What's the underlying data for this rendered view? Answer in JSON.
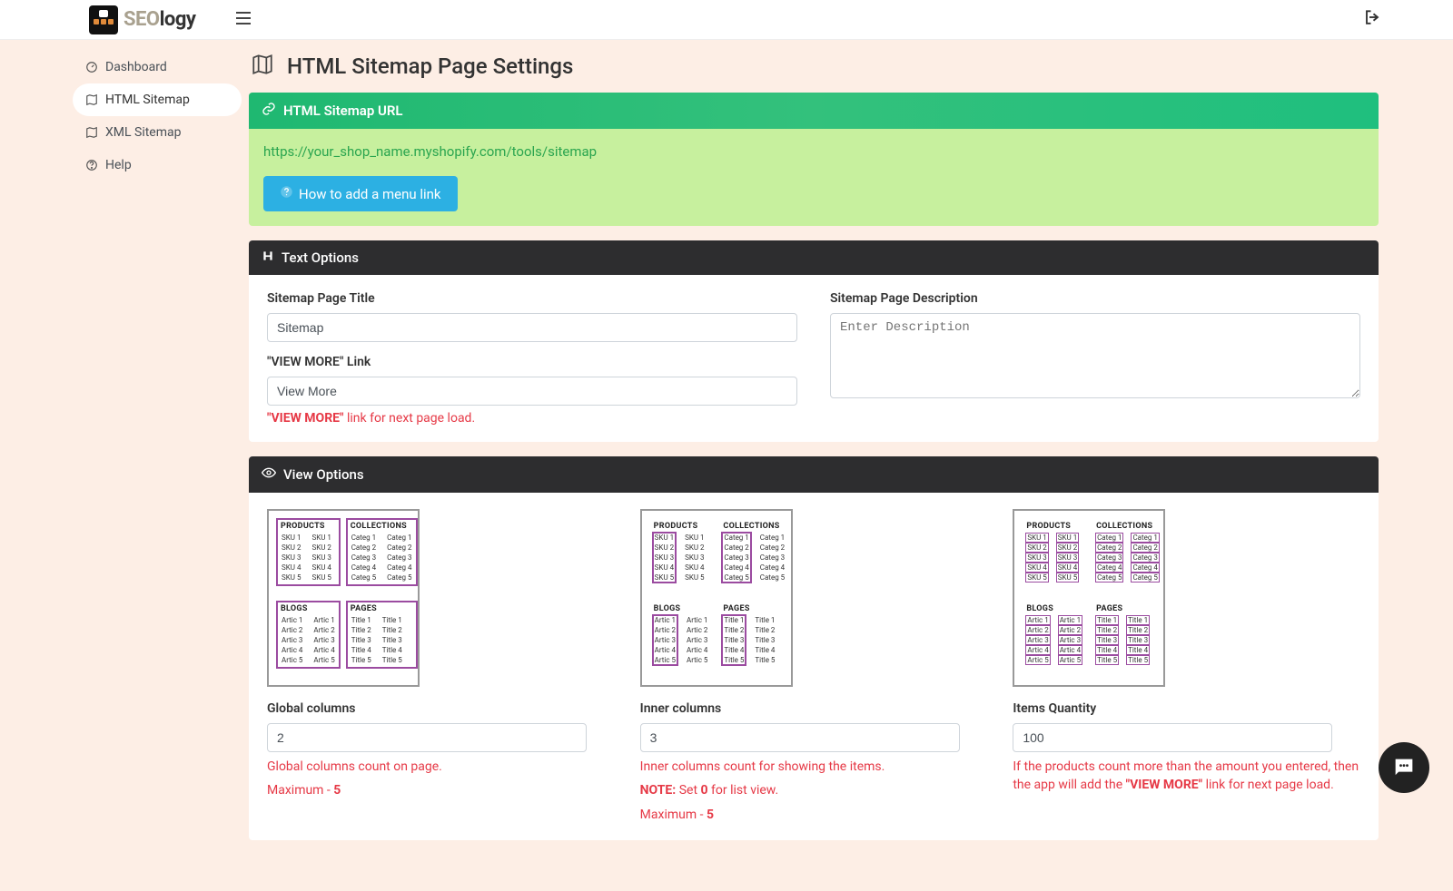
{
  "brand": {
    "seo": "SEO",
    "logy": "logy"
  },
  "sidebar": {
    "items": [
      {
        "label": "Dashboard",
        "icon": "dashboard-icon"
      },
      {
        "label": "HTML Sitemap",
        "icon": "map-icon",
        "active": true
      },
      {
        "label": "XML Sitemap",
        "icon": "map-icon"
      },
      {
        "label": "Help",
        "icon": "help-icon"
      }
    ]
  },
  "page": {
    "title": "HTML Sitemap Page Settings"
  },
  "urlPanel": {
    "heading": "HTML Sitemap URL",
    "url": "https://your_shop_name.myshopify.com/tools/sitemap",
    "howto": "How to add a menu link"
  },
  "textOptions": {
    "heading": "Text Options",
    "titleLabel": "Sitemap Page Title",
    "titleValue": "Sitemap",
    "descLabel": "Sitemap Page Description",
    "descPlaceholder": "Enter Description",
    "viewMoreLabel": "\"VIEW MORE\" Link",
    "viewMoreValue": "View More",
    "viewMoreHelpStrong": "\"VIEW MORE\"",
    "viewMoreHelpRest": " link for next page load."
  },
  "viewOptions": {
    "heading": "View Options",
    "preview": {
      "sections": [
        "PRODUCTS",
        "COLLECTIONS",
        "BLOGS",
        "PAGES"
      ],
      "sku": [
        "SKU 1",
        "SKU 2",
        "SKU 3",
        "SKU 4",
        "SKU 5"
      ],
      "categ": [
        "Categ 1",
        "Categ 2",
        "Categ 3",
        "Categ 4",
        "Categ 5"
      ],
      "artic": [
        "Artic 1",
        "Artic 2",
        "Artic 3",
        "Artic 4",
        "Artic 5"
      ],
      "title": [
        "Title 1",
        "Title 2",
        "Title 3",
        "Title 4",
        "Title 5"
      ]
    },
    "global": {
      "label": "Global columns",
      "value": "2",
      "help1": "Global columns count on page.",
      "maxLabel": "Maximum - ",
      "maxValue": "5"
    },
    "inner": {
      "label": "Inner columns",
      "value": "3",
      "help1": "Inner columns count for showing the items.",
      "noteLabel": "NOTE:",
      "noteSet": " Set ",
      "noteZero": "0",
      "noteRest": " for list view.",
      "maxLabel": "Maximum - ",
      "maxValue": "5"
    },
    "items": {
      "label": "Items Quantity",
      "value": "100",
      "help1a": "If the products count more than the amount you entered, then the app will add the ",
      "help1b": "\"VIEW MORE\"",
      "help1c": " link for next page load."
    }
  }
}
